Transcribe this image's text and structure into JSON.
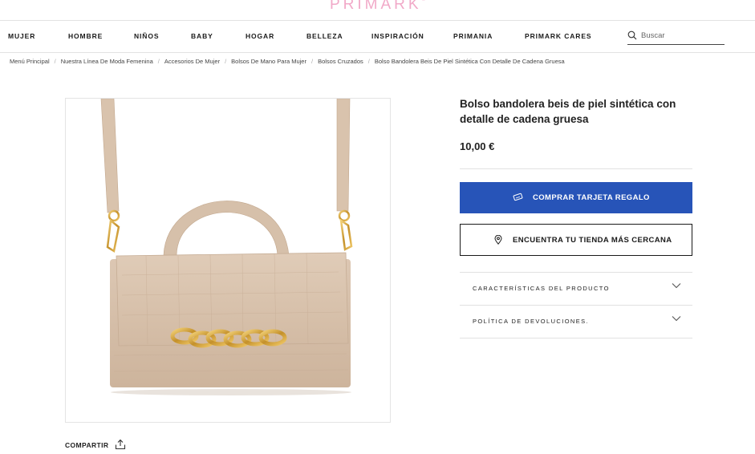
{
  "header": {
    "logo": "PRIMARK",
    "logo_mark": "®"
  },
  "nav": {
    "items": [
      "MUJER",
      "HOMBRE",
      "NIÑOS",
      "BABY",
      "HOGAR",
      "BELLEZA",
      "INSPIRACIÓN",
      "PRIMANIA",
      "PRIMARK CARES"
    ],
    "search_placeholder": "Buscar"
  },
  "breadcrumb": [
    "Menú Principal",
    "Nuestra Línea De Moda Femenina",
    "Accesorios De Mujer",
    "Bolsos De Mano Para Mujer",
    "Bolsos Cruzados",
    "Bolso Bandolera Beis De Piel Sintética Con Detalle De Cadena Gruesa"
  ],
  "breadcrumb_separator": "/",
  "product": {
    "title": "Bolso bandolera beis de piel sintética con detalle de cadena gruesa",
    "price": "10,00 €",
    "image_alt": "beige-crossbody-bag-with-gold-chain"
  },
  "actions": {
    "gift_card_label": "COMPRAR TARJETA REGALO",
    "gift_card_icon": "gift-card-icon",
    "find_store_label": "ENCUENTRA TU TIENDA MÁS CERCANA",
    "find_store_icon": "location-pin-icon"
  },
  "accordions": [
    {
      "label": "CARACTERÍSTICAS DEL PRODUCTO",
      "icon": "chevron-down-icon"
    },
    {
      "label": "POLÍTICA DE DEVOLUCIONES.",
      "icon": "chevron-down-icon"
    }
  ],
  "share": {
    "label": "COMPARTIR",
    "icon": "share-icon"
  },
  "colors": {
    "accent": "#2754b8",
    "logo": "#f1a9c8",
    "bag": "#d8c2ad",
    "chain": "#c99a2e"
  }
}
